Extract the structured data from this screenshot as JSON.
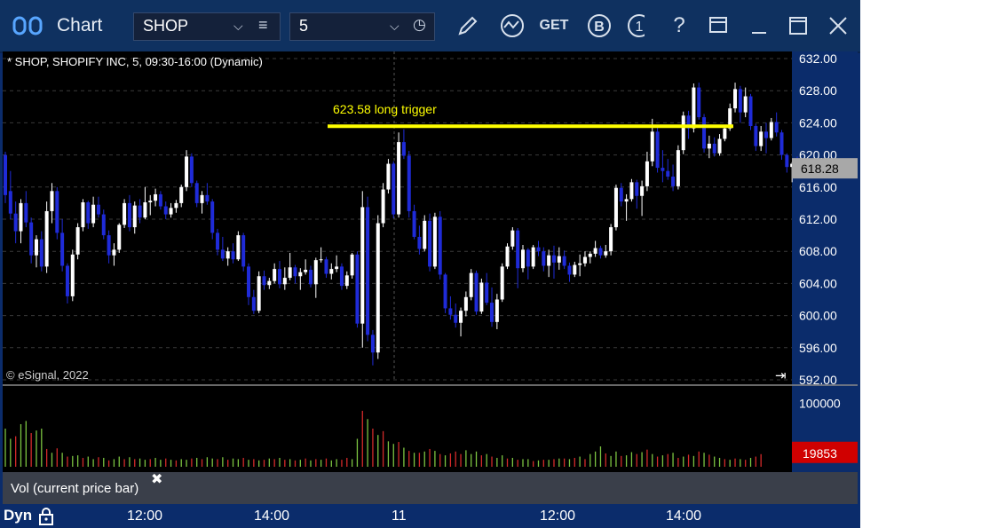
{
  "window": {
    "title": "Chart",
    "symbol_value": "SHOP",
    "interval_value": "5",
    "icons": [
      "menu-icon",
      "clock-icon",
      "pencil-icon",
      "study-icon",
      "get-icon",
      "b-icon",
      "info-icon",
      "help-icon",
      "layout-icon",
      "minimize-icon",
      "maximize-icon",
      "close-icon"
    ]
  },
  "chart": {
    "header": "* SHOP, SHOPIFY INC, 5, 09:30-16:00 (Dynamic)",
    "copyright": "© eSignal, 2022",
    "annotation_text": "623.58 long trigger",
    "last_price_label": "618.28",
    "volume_value_label": "19853",
    "volume_panel_label": "Vol (current price bar)",
    "dyn_label": "Dyn"
  },
  "colors": {
    "up": "#ffffff",
    "down": "#1f2bd8",
    "trigger": "#ffff00",
    "vol_up": "#7cc441",
    "vol_down": "#d42a2a",
    "axis_bg": "#0b2c6b"
  },
  "chart_data": {
    "type": "candlestick",
    "price_axis": {
      "ticks": [
        "632.00",
        "628.00",
        "624.00",
        "620.00",
        "616.00",
        "612.00",
        "608.00",
        "604.00",
        "600.00",
        "596.00",
        "592.00"
      ],
      "range": [
        592,
        632
      ]
    },
    "volume_axis": {
      "ticks": [
        "100000"
      ]
    },
    "time_axis": {
      "labels": [
        "12:00",
        "14:00",
        "11",
        "12:00",
        "14:00"
      ]
    },
    "trigger_level": 623.58,
    "last_price": 618.28,
    "last_volume": 19853,
    "ohlc": [
      [
        620,
        620.4,
        614,
        615
      ],
      [
        615.5,
        618,
        612,
        612.7
      ],
      [
        612.7,
        614.2,
        609,
        610.5
      ],
      [
        610.5,
        614.5,
        609,
        614
      ],
      [
        614,
        615.5,
        611,
        611.6
      ],
      [
        611.6,
        612.2,
        606.5,
        607.5
      ],
      [
        607.5,
        610,
        606,
        609.5
      ],
      [
        609.5,
        610.5,
        605.5,
        606.1
      ],
      [
        606.1,
        614.2,
        605.3,
        613
      ],
      [
        613,
        616.5,
        611.5,
        615.5
      ],
      [
        615.5,
        616,
        609.5,
        610.3
      ],
      [
        610.3,
        612,
        605.5,
        606.2
      ],
      [
        606.2,
        606.5,
        601.5,
        602.4
      ],
      [
        602.4,
        608.2,
        601.8,
        607.6
      ],
      [
        607.6,
        611.5,
        607,
        611
      ],
      [
        611,
        614.5,
        610.5,
        614.1
      ],
      [
        614.1,
        614.3,
        610.8,
        611.5
      ],
      [
        611.5,
        614.8,
        611,
        613.8
      ],
      [
        613.8,
        614.8,
        612.2,
        612.6
      ],
      [
        612.6,
        613.2,
        609.5,
        610
      ],
      [
        610,
        610.6,
        606.5,
        607.5
      ],
      [
        607.5,
        609,
        606.2,
        608.2
      ],
      [
        608.2,
        611.5,
        607.8,
        611.3
      ],
      [
        611.3,
        614.5,
        610.9,
        614
      ],
      [
        614,
        615,
        610.5,
        611
      ],
      [
        611,
        614.2,
        610.2,
        613.7
      ],
      [
        613.7,
        614.5,
        611.5,
        612.2
      ],
      [
        612.2,
        616,
        612,
        614.1
      ],
      [
        614.1,
        615,
        612.5,
        614.3
      ],
      [
        614.3,
        615.8,
        613.6,
        615.1
      ],
      [
        615.1,
        615.5,
        613.2,
        613.6
      ],
      [
        613.6,
        614.2,
        612,
        612.6
      ],
      [
        612.6,
        614,
        612.2,
        613.4
      ],
      [
        613.4,
        614.4,
        612.8,
        614
      ],
      [
        614,
        616.3,
        613.5,
        616
      ],
      [
        616,
        620.6,
        615.5,
        619.8
      ],
      [
        619.8,
        620.2,
        616,
        616.5
      ],
      [
        616.5,
        616.8,
        613.5,
        614
      ],
      [
        614,
        615.5,
        612.7,
        615
      ],
      [
        615,
        616.5,
        613.8,
        614.2
      ],
      [
        614.2,
        614.5,
        609.5,
        610.3
      ],
      [
        610.3,
        610.8,
        607.5,
        608.2
      ],
      [
        608.2,
        609.8,
        606.8,
        607.1
      ],
      [
        607.1,
        608.5,
        606.2,
        608
      ],
      [
        608,
        609,
        606.5,
        607
      ],
      [
        607,
        610.5,
        606.8,
        610
      ],
      [
        610,
        610.3,
        605.5,
        606.1
      ],
      [
        606.1,
        606.5,
        601.3,
        602.3
      ],
      [
        602.3,
        603.2,
        600.2,
        600.6
      ],
      [
        600.6,
        605.5,
        600.3,
        604.9
      ],
      [
        604.9,
        605.6,
        603.2,
        603.8
      ],
      [
        603.8,
        604.7,
        603.3,
        604.3
      ],
      [
        604.3,
        606.5,
        604,
        605.8
      ],
      [
        605.8,
        606.8,
        603.4,
        603.9
      ],
      [
        603.9,
        606,
        603.2,
        604.7
      ],
      [
        604.7,
        607.8,
        604.4,
        606
      ],
      [
        606,
        606.3,
        604,
        604.9
      ],
      [
        604.9,
        605.9,
        603.2,
        605.4
      ],
      [
        605.4,
        607,
        605.1,
        605.7
      ],
      [
        605.7,
        606.2,
        603.5,
        603.9
      ],
      [
        603.9,
        607.2,
        602.2,
        606.9
      ],
      [
        606.9,
        608.5,
        606.6,
        607
      ],
      [
        607,
        607.3,
        604.7,
        605.2
      ],
      [
        605.2,
        606.5,
        604.5,
        605.8
      ],
      [
        605.8,
        607.5,
        605.4,
        606.1
      ],
      [
        606.1,
        606.5,
        603.2,
        603.7
      ],
      [
        603.7,
        605.5,
        603.3,
        605
      ],
      [
        605,
        607.8,
        604.6,
        607.6
      ],
      [
        607.6,
        608,
        598.5,
        599
      ],
      [
        599,
        615.5,
        596,
        613.5
      ],
      [
        613.5,
        614.8,
        596.8,
        597.6
      ],
      [
        597.6,
        598.2,
        593.8,
        595.4
      ],
      [
        595.4,
        612.5,
        594.6,
        611.5
      ],
      [
        611.5,
        616.5,
        611,
        615.7
      ],
      [
        615.7,
        619.5,
        615.2,
        618.9
      ],
      [
        618.9,
        619.2,
        612.1,
        612.6
      ],
      [
        612.6,
        622.8,
        612.2,
        621.6
      ],
      [
        621.6,
        623.2,
        619.5,
        619.9
      ],
      [
        619.9,
        620.5,
        612.2,
        613
      ],
      [
        613,
        613.8,
        609.5,
        609.8
      ],
      [
        609.8,
        611.2,
        607.6,
        608.3
      ],
      [
        608.3,
        612.5,
        608,
        611.8
      ],
      [
        611.8,
        612.7,
        605.5,
        606.1
      ],
      [
        606.1,
        612.8,
        605.8,
        612.3
      ],
      [
        612.3,
        613,
        604.5,
        605.1
      ],
      [
        605.1,
        605.3,
        600.3,
        600.9
      ],
      [
        600.9,
        602.4,
        599.5,
        600.1
      ],
      [
        600.1,
        601.5,
        598.5,
        599.1
      ],
      [
        599.1,
        601,
        597.4,
        600.6
      ],
      [
        600.6,
        603,
        599.9,
        602.3
      ],
      [
        602.3,
        605.8,
        601.9,
        605.3
      ],
      [
        605.3,
        605.6,
        600.1,
        600.5
      ],
      [
        600.5,
        604.6,
        600.2,
        604.1
      ],
      [
        604.1,
        605.3,
        601.3,
        601.6
      ],
      [
        601.6,
        603.5,
        598.6,
        599.2
      ],
      [
        599.2,
        602.7,
        598.3,
        602
      ],
      [
        602,
        606.5,
        601.7,
        606.1
      ],
      [
        606.1,
        609,
        605.8,
        608.6
      ],
      [
        608.6,
        611,
        608.2,
        610.6
      ],
      [
        610.6,
        610.9,
        603.4,
        605.9
      ],
      [
        605.9,
        608.8,
        605.4,
        608.2
      ],
      [
        608.2,
        608.4,
        604.5,
        606.1
      ],
      [
        606.1,
        608.8,
        605.8,
        608.5
      ],
      [
        608.5,
        609.3,
        607.4,
        608
      ],
      [
        608,
        608.5,
        605.5,
        606.2
      ],
      [
        606.2,
        608.2,
        604.8,
        607.5
      ],
      [
        607.5,
        608.7,
        604.6,
        606.6
      ],
      [
        606.6,
        608.5,
        605.7,
        607.4
      ],
      [
        607.4,
        608.1,
        605.8,
        606.2
      ],
      [
        606.2,
        606.6,
        604.2,
        605.1
      ],
      [
        605.1,
        606.7,
        604.8,
        606.3
      ],
      [
        606.3,
        607.6,
        604.9,
        606.5
      ],
      [
        606.5,
        608,
        606.1,
        607.3
      ],
      [
        607.3,
        608,
        606.5,
        607.7
      ],
      [
        607.7,
        609.3,
        607.3,
        608.4
      ],
      [
        608.4,
        608.7,
        607.1,
        607.5
      ],
      [
        607.5,
        608.8,
        607.2,
        608
      ],
      [
        608,
        611.4,
        607.5,
        611
      ],
      [
        611,
        616.3,
        610.6,
        615.9
      ],
      [
        615.9,
        616.5,
        613.6,
        614.2
      ],
      [
        614.2,
        615.1,
        611.8,
        614.5
      ],
      [
        614.5,
        617,
        614.2,
        616.6
      ],
      [
        616.6,
        616.9,
        613.3,
        614.9
      ],
      [
        614.9,
        616.8,
        612.4,
        616.1
      ],
      [
        616.1,
        620.4,
        615.5,
        619.2
      ],
      [
        619.2,
        624.5,
        618.6,
        622.9
      ],
      [
        622.9,
        623.5,
        617.8,
        618.4
      ],
      [
        618.4,
        620.6,
        616.6,
        618
      ],
      [
        618,
        619.5,
        616.9,
        617.3
      ],
      [
        617.3,
        618.8,
        615.5,
        616.1
      ],
      [
        616.1,
        621.2,
        615.7,
        620.6
      ],
      [
        620.6,
        625.4,
        620.1,
        624.9
      ],
      [
        624.9,
        625.5,
        622,
        623.3
      ],
      [
        623.3,
        628.9,
        622.8,
        628.4
      ],
      [
        628.4,
        629,
        624.4,
        624.7
      ],
      [
        624.7,
        625.1,
        620.3,
        620.8
      ],
      [
        620.8,
        622.4,
        619.6,
        621.4
      ],
      [
        621.4,
        622.2,
        619.8,
        620.2
      ],
      [
        620.2,
        622.6,
        619.9,
        622
      ],
      [
        622,
        623.6,
        621.7,
        623.3
      ],
      [
        623.3,
        626.4,
        623,
        625.8
      ],
      [
        625.8,
        629,
        625.3,
        628.2
      ],
      [
        628.2,
        628.6,
        624,
        625.3
      ],
      [
        625.3,
        628.4,
        624.7,
        627.3
      ],
      [
        627.3,
        627.6,
        623.1,
        623.6
      ],
      [
        623.6,
        623.9,
        620.5,
        621.1
      ],
      [
        621.1,
        623.6,
        620.5,
        622.9
      ],
      [
        622.9,
        624,
        620.2,
        622.1
      ],
      [
        622.1,
        624.6,
        621.8,
        624.1
      ],
      [
        624.1,
        625.3,
        622.3,
        622.8
      ],
      [
        622.8,
        623.1,
        619.4,
        620
      ],
      [
        620,
        620.2,
        617.8,
        618.5
      ],
      [
        618.5,
        619.1,
        616.6,
        618.9
      ],
      [
        618.9,
        619.8,
        617.8,
        618.28
      ]
    ],
    "volume": [
      [
        60000,
        1
      ],
      [
        44000,
        1
      ],
      [
        48000,
        0
      ],
      [
        67000,
        1
      ],
      [
        72000,
        1
      ],
      [
        53000,
        0
      ],
      [
        57000,
        1
      ],
      [
        60000,
        1
      ],
      [
        28000,
        0
      ],
      [
        22000,
        1
      ],
      [
        29000,
        0
      ],
      [
        22000,
        1
      ],
      [
        16000,
        0
      ],
      [
        17000,
        1
      ],
      [
        18000,
        1
      ],
      [
        14000,
        0
      ],
      [
        16000,
        1
      ],
      [
        12000,
        1
      ],
      [
        15000,
        0
      ],
      [
        14000,
        1
      ],
      [
        10000,
        0
      ],
      [
        12000,
        1
      ],
      [
        16000,
        1
      ],
      [
        12000,
        0
      ],
      [
        15000,
        1
      ],
      [
        12000,
        0
      ],
      [
        13000,
        1
      ],
      [
        11000,
        1
      ],
      [
        12000,
        0
      ],
      [
        14000,
        1
      ],
      [
        11000,
        1
      ],
      [
        13000,
        0
      ],
      [
        11000,
        1
      ],
      [
        10000,
        0
      ],
      [
        12000,
        1
      ],
      [
        11000,
        1
      ],
      [
        13000,
        0
      ],
      [
        14000,
        1
      ],
      [
        12000,
        0
      ],
      [
        15000,
        1
      ],
      [
        13000,
        1
      ],
      [
        12000,
        0
      ],
      [
        15000,
        1
      ],
      [
        11000,
        0
      ],
      [
        13000,
        1
      ],
      [
        12000,
        1
      ],
      [
        14000,
        0
      ],
      [
        11000,
        1
      ],
      [
        12000,
        0
      ],
      [
        10000,
        1
      ],
      [
        11000,
        0
      ],
      [
        13000,
        1
      ],
      [
        12000,
        0
      ],
      [
        14000,
        1
      ],
      [
        11000,
        0
      ],
      [
        12000,
        1
      ],
      [
        10000,
        0
      ],
      [
        11000,
        1
      ],
      [
        13000,
        0
      ],
      [
        10000,
        1
      ],
      [
        12000,
        0
      ],
      [
        11000,
        1
      ],
      [
        13000,
        0
      ],
      [
        10000,
        1
      ],
      [
        12000,
        1
      ],
      [
        11000,
        0
      ],
      [
        14000,
        0
      ],
      [
        12000,
        1
      ],
      [
        44000,
        1
      ],
      [
        88000,
        0
      ],
      [
        75000,
        1
      ],
      [
        60000,
        0
      ],
      [
        50000,
        1
      ],
      [
        56000,
        0
      ],
      [
        40000,
        1
      ],
      [
        36000,
        1
      ],
      [
        39000,
        0
      ],
      [
        30000,
        1
      ],
      [
        25000,
        0
      ],
      [
        22000,
        1
      ],
      [
        22000,
        0
      ],
      [
        24000,
        1
      ],
      [
        28000,
        0
      ],
      [
        25000,
        1
      ],
      [
        20000,
        0
      ],
      [
        18000,
        1
      ],
      [
        21000,
        0
      ],
      [
        24000,
        0
      ],
      [
        20000,
        0
      ],
      [
        26000,
        1
      ],
      [
        20000,
        1
      ],
      [
        24000,
        1
      ],
      [
        18000,
        0
      ],
      [
        20000,
        1
      ],
      [
        16000,
        0
      ],
      [
        14000,
        1
      ],
      [
        18000,
        1
      ],
      [
        13000,
        0
      ],
      [
        14000,
        1
      ],
      [
        11000,
        0
      ],
      [
        12000,
        1
      ],
      [
        12000,
        1
      ],
      [
        9000,
        0
      ],
      [
        10000,
        1
      ],
      [
        11000,
        0
      ],
      [
        11000,
        1
      ],
      [
        12000,
        0
      ],
      [
        13000,
        1
      ],
      [
        13000,
        0
      ],
      [
        12000,
        1
      ],
      [
        14000,
        0
      ],
      [
        16000,
        1
      ],
      [
        12000,
        0
      ],
      [
        20000,
        1
      ],
      [
        24000,
        1
      ],
      [
        32000,
        1
      ],
      [
        21000,
        0
      ],
      [
        17000,
        1
      ],
      [
        24000,
        1
      ],
      [
        17000,
        0
      ],
      [
        18000,
        1
      ],
      [
        23000,
        1
      ],
      [
        20000,
        0
      ],
      [
        23000,
        1
      ],
      [
        27000,
        0
      ],
      [
        20000,
        1
      ],
      [
        16000,
        0
      ],
      [
        18000,
        1
      ],
      [
        20000,
        0
      ],
      [
        22000,
        1
      ],
      [
        14000,
        0
      ],
      [
        16000,
        1
      ],
      [
        19000,
        0
      ],
      [
        17000,
        1
      ],
      [
        24000,
        0
      ],
      [
        22000,
        1
      ],
      [
        19000,
        0
      ],
      [
        16000,
        1
      ],
      [
        14000,
        1
      ],
      [
        12000,
        0
      ],
      [
        11000,
        1
      ],
      [
        13000,
        0
      ],
      [
        12000,
        1
      ],
      [
        11000,
        0
      ],
      [
        14000,
        1
      ],
      [
        16000,
        0
      ],
      [
        19853,
        0
      ]
    ]
  }
}
